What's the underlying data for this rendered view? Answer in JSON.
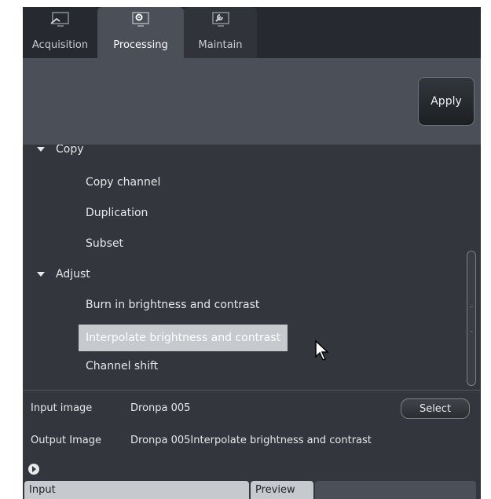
{
  "tabs": [
    {
      "label": "Acquisition",
      "icon": "monitor-icon",
      "active": false
    },
    {
      "label": "Processing",
      "icon": "gear-monitor-icon",
      "active": true
    },
    {
      "label": "Maintain",
      "icon": "wrench-monitor-icon",
      "active": false
    }
  ],
  "header": {
    "apply_label": "Apply"
  },
  "list": {
    "groups": [
      {
        "label": "Copy",
        "expanded": true,
        "items": [
          "Copy channel",
          "Duplication",
          "Subset"
        ]
      },
      {
        "label": "Adjust",
        "expanded": true,
        "items": [
          "Burn in brightness and contrast",
          "Interpolate brightness and contrast",
          "Channel shift"
        ]
      }
    ],
    "selected_item": "Interpolate brightness and contrast"
  },
  "io": {
    "input_label": "Input image",
    "input_value": "Dronpa 005",
    "select_label": "Select",
    "output_label": "Output Image",
    "output_value": "Dronpa 005Interpolate brightness and contrast"
  },
  "bottom_tabs": [
    "Input",
    "Preview"
  ],
  "colors": {
    "panel": "#33373d",
    "tabbar": "#262a30",
    "active_tab": "#4b5058",
    "selection": "#c6cacf",
    "text": "#e6e8eb"
  }
}
